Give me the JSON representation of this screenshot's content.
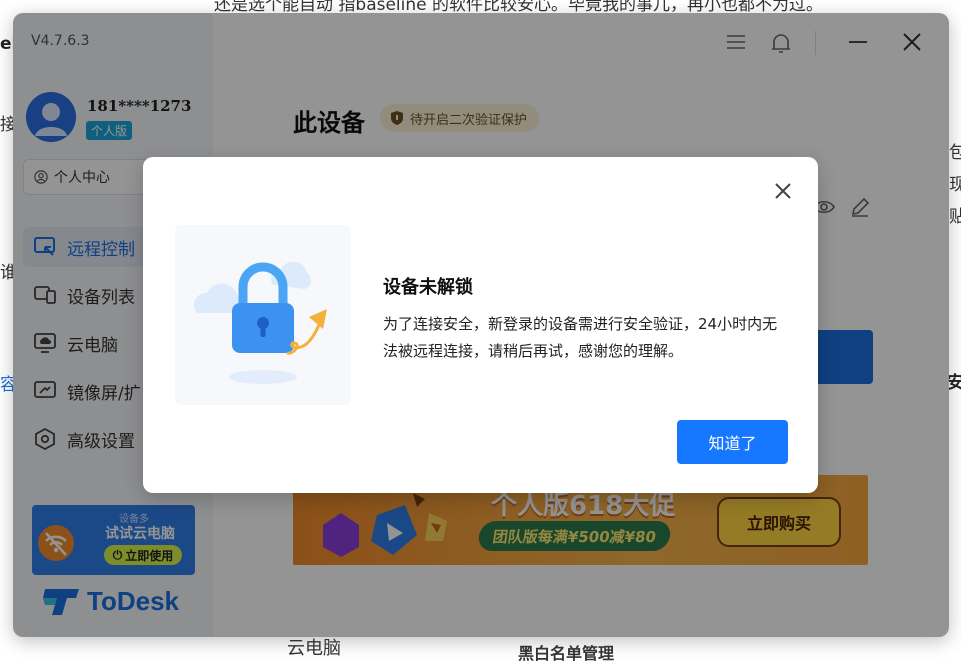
{
  "background_page": {
    "top_line": "还是选个能自动 指baseline 的软件比较安心。毕竟我的事儿，再小也都不为过。",
    "left_fragments": [
      "ek.",
      "接",
      "谁",
      "容"
    ],
    "right_fragments": [
      "包",
      "现",
      "贴",
      "安"
    ]
  },
  "app": {
    "version": "V4.7.6.3",
    "user": {
      "phone": "181****1273",
      "plan_badge": "个人版"
    },
    "personal_center": "个人中心",
    "nav": [
      {
        "label": "远程控制",
        "icon": "remote-control-icon",
        "active": true
      },
      {
        "label": "设备列表",
        "icon": "device-list-icon",
        "active": false
      },
      {
        "label": "云电脑",
        "icon": "cloud-pc-icon",
        "active": false
      },
      {
        "label": "镜像屏/扩",
        "icon": "mirror-screen-icon",
        "active": false
      },
      {
        "label": "高级设置",
        "icon": "settings-hexagon-icon",
        "active": false
      }
    ],
    "promo_card": {
      "tag": "设备多",
      "title": "试试云电脑",
      "button": "立即使用"
    },
    "logo_text": "ToDesk",
    "main": {
      "page_title": "此设备",
      "verify_badge": "待开启二次验证保护",
      "banner": {
        "headline": "个人版618大促",
        "subline": "团队版每满¥500减¥80",
        "buy_button": "立即购买"
      },
      "bottom_fragments": [
        "云电脑",
        "黑白名单管理"
      ]
    }
  },
  "dialog": {
    "title": "设备未解锁",
    "message": "为了连接安全，新登录的设备需进行安全验证，24小时内无法被远程连接，请稍后再试，感谢您的理解。",
    "confirm_button": "知道了"
  },
  "colors": {
    "accent": "#1677ff",
    "brand_blue": "#1a6fe0",
    "overlay": "rgba(0,0,0,0.42)"
  }
}
